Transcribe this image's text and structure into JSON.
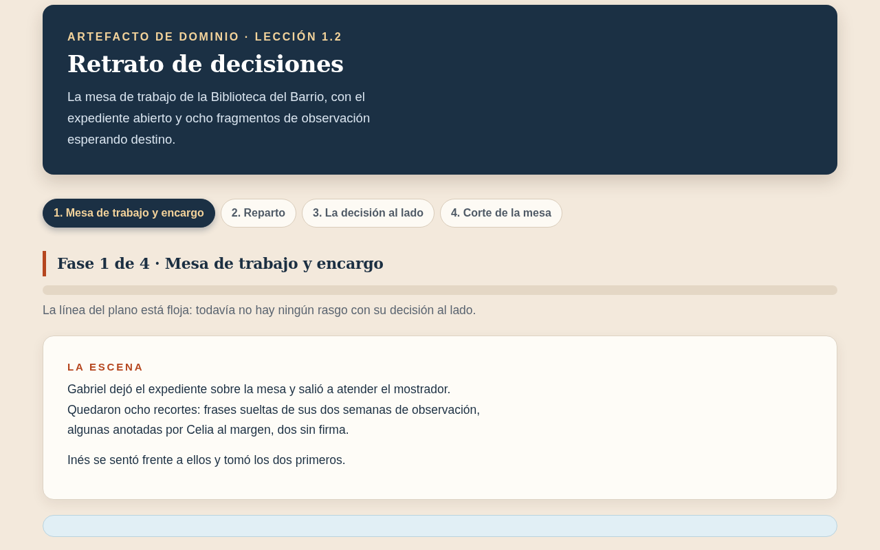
{
  "header": {
    "eyebrow": "ARTEFACTO DE DOMINIO · LECCIÓN 1.2",
    "title": "Retrato de decisiones",
    "lead": "La mesa de trabajo de la Biblioteca del Barrio, con el expediente abierto y ocho fragmentos de observación esperando destino."
  },
  "tabs": [
    {
      "label": "1. Mesa de trabajo y encargo",
      "selected": true
    },
    {
      "label": "2. Reparto",
      "selected": false
    },
    {
      "label": "3. La decisión al lado",
      "selected": false
    },
    {
      "label": "4. Corte de la mesa",
      "selected": false
    }
  ],
  "phase": {
    "title": "Fase 1 de 4 · Mesa de trabajo y encargo",
    "progress": {
      "level": 0
    },
    "note": "La línea del plano está floja: todavía no hay ningún rasgo con su decisión al lado."
  },
  "scene": {
    "label": "LA ESCENA",
    "paragraphs": [
      "Gabriel dejó el expediente sobre la mesa y salió a atender el mostrador. Quedaron ocho recortes: frases sueltas de sus dos semanas de observación, algunas anotadas por Celia al margen, dos sin firma.",
      "Inés se sentó frente a ellos y tomó los dos primeros."
    ]
  }
}
